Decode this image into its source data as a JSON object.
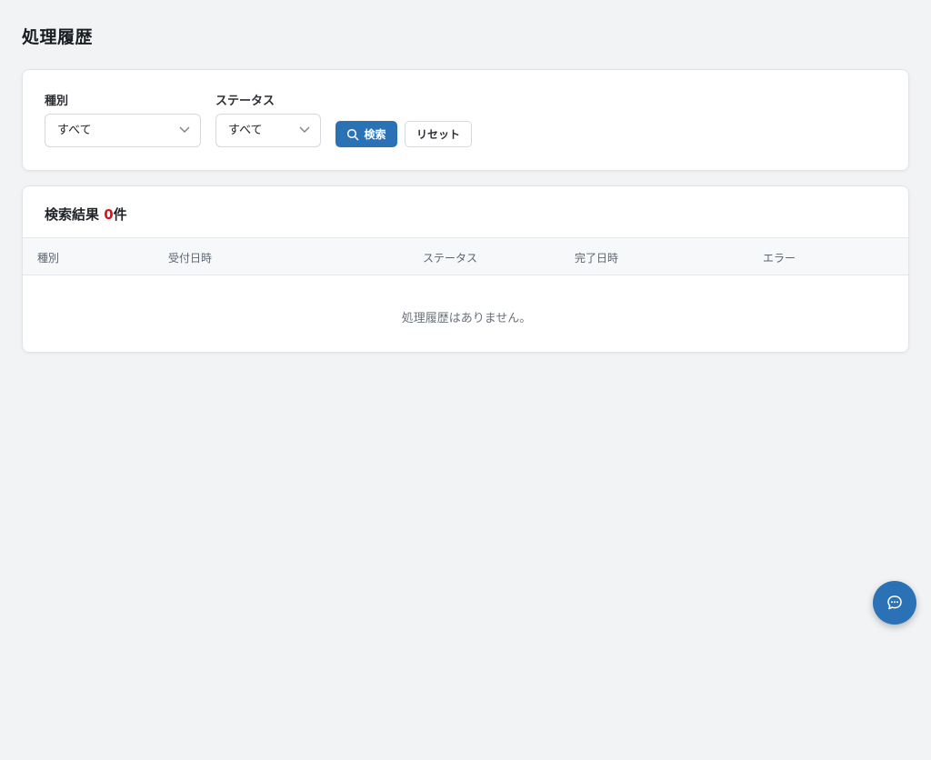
{
  "page": {
    "title": "処理履歴"
  },
  "filters": {
    "type": {
      "label": "種別",
      "value": "すべて"
    },
    "status": {
      "label": "ステータス",
      "value": "すべて"
    },
    "search_label": "検索",
    "reset_label": "リセット"
  },
  "results": {
    "header_prefix": "検索結果 ",
    "count": "0",
    "header_suffix": "件",
    "columns": [
      "種別",
      "受付日時",
      "ステータス",
      "完了日時",
      "エラー"
    ],
    "empty_message": "処理履歴はありません。"
  },
  "colors": {
    "accent": "#2a72b5",
    "count_highlight": "#d9141c",
    "background": "#f2f3f5"
  },
  "icons": {
    "search": "search-icon",
    "dropdown": "chevron-down-icon",
    "chat": "chat-bubble-icon"
  }
}
